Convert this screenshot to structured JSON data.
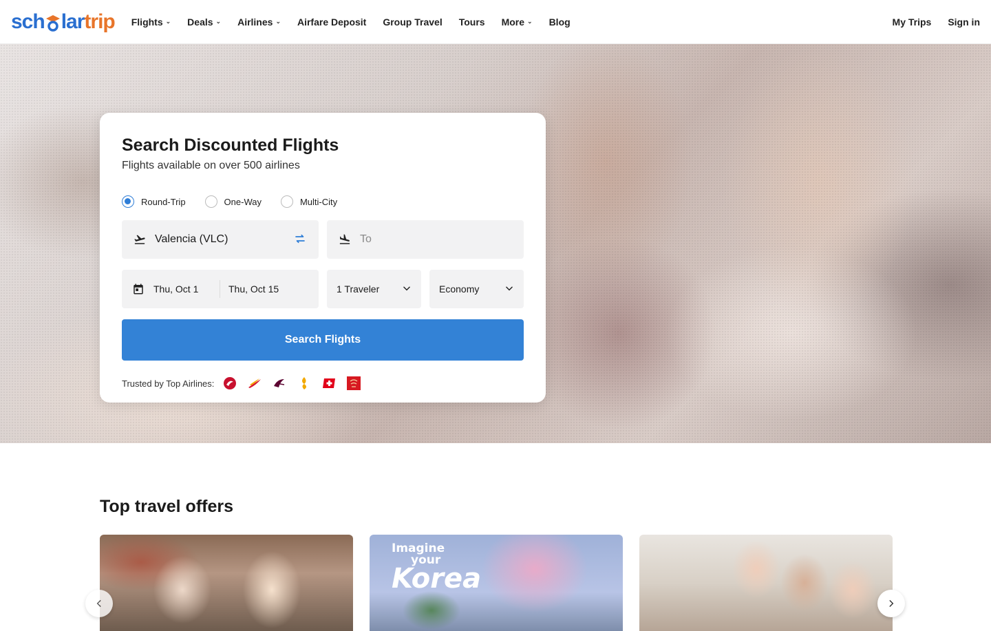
{
  "brand": {
    "part1": "sch",
    "part2": "lar",
    "part3": "trip",
    "colors": {
      "blue": "#2a6fd0",
      "orange": "#e8752a"
    }
  },
  "nav": {
    "items": [
      {
        "label": "Flights",
        "dropdown": true
      },
      {
        "label": "Deals",
        "dropdown": true
      },
      {
        "label": "Airlines",
        "dropdown": true
      },
      {
        "label": "Airfare Deposit",
        "dropdown": false
      },
      {
        "label": "Group Travel",
        "dropdown": false
      },
      {
        "label": "Tours",
        "dropdown": false
      },
      {
        "label": "More",
        "dropdown": true
      },
      {
        "label": "Blog",
        "dropdown": false
      }
    ],
    "my_trips": "My Trips",
    "sign_in": "Sign in"
  },
  "search": {
    "title": "Search Discounted Flights",
    "subtitle": "Flights available on over 500 airlines",
    "trip_types": [
      {
        "label": "Round-Trip",
        "selected": true
      },
      {
        "label": "One-Way",
        "selected": false
      },
      {
        "label": "Multi-City",
        "selected": false
      }
    ],
    "from_value": "Valencia (VLC)",
    "to_placeholder": "To",
    "depart_date": "Thu, Oct 1",
    "return_date": "Thu, Oct 15",
    "travelers": "1 Traveler",
    "cabin": "Economy",
    "button": "Search Flights",
    "trusted_label": "Trusted by Top Airlines:",
    "airlines": [
      "turkish-airlines-logo",
      "iberia-logo",
      "qatar-airways-logo",
      "singapore-airlines-logo",
      "swiss-logo",
      "emirates-logo"
    ],
    "accent": "#3382d6"
  },
  "offers": {
    "title": "Top travel offers",
    "korea_line1": "Imagine",
    "korea_line2": "your",
    "korea_line3": "Korea"
  }
}
